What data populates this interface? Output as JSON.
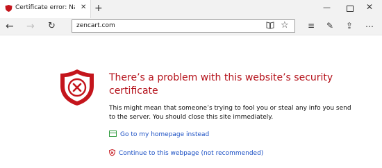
{
  "tab": {
    "title": "Certificate error: Naviga",
    "close": "✕",
    "new_tab": "+"
  },
  "window": {
    "minimize": "—",
    "close": "✕"
  },
  "toolbar": {
    "back": "←",
    "forward": "→",
    "refresh": "↻",
    "address": "zencart.com",
    "reading_view": "📖",
    "favorite": "☆",
    "hub": "≡",
    "web_note": "✎",
    "share": "⇪",
    "more": "…"
  },
  "error": {
    "headline": "There’s a problem with this website’s security certificate",
    "description": "This might mean that someone’s trying to fool you or steal any info you send to the server. You should close this site immediately.",
    "homepage_link": "Go to my homepage instead",
    "continue_link": "Continue to this webpage (not recommended)"
  },
  "colors": {
    "error_red": "#b5121b",
    "link_blue": "#1a4fc4",
    "home_green": "#2e9a3c"
  },
  "icons": {
    "tab": "shield-error-icon",
    "main": "shield-x-icon",
    "homepage": "home-page-icon",
    "continue": "shield-warning-icon"
  }
}
